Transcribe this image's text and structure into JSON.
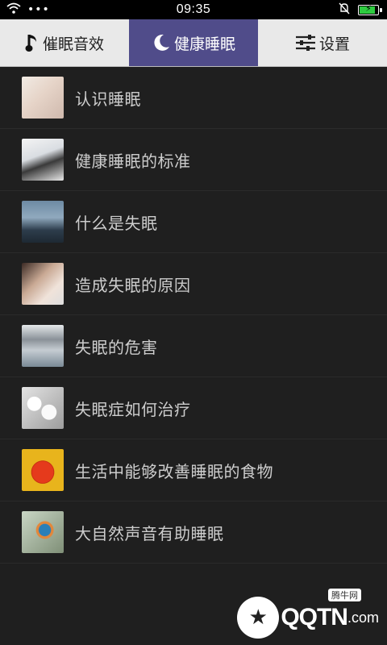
{
  "status_bar": {
    "time": "09:35",
    "battery_level": 0.9
  },
  "tabs": [
    {
      "label": "催眠音效",
      "icon": "music-note-icon",
      "active": false
    },
    {
      "label": "健康睡眠",
      "icon": "moon-icon",
      "active": true
    },
    {
      "label": "设置",
      "icon": "sliders-icon",
      "active": false
    }
  ],
  "items": [
    {
      "label": "认识睡眠",
      "thumb": "sleeping-baby-image"
    },
    {
      "label": "健康睡眠的标准",
      "thumb": "woman-resting-image"
    },
    {
      "label": "什么是失眠",
      "thumb": "person-at-window-image"
    },
    {
      "label": "造成失眠的原因",
      "thumb": "woman-headache-image"
    },
    {
      "label": "失眠的危害",
      "thumb": "eye-mask-image"
    },
    {
      "label": "失眠症如何治疗",
      "thumb": "pills-image"
    },
    {
      "label": "生活中能够改善睡眠的食物",
      "thumb": "apple-image"
    },
    {
      "label": "大自然声音有助睡眠",
      "thumb": "kingfisher-image"
    }
  ],
  "watermark": {
    "brand": "QQTN",
    "suffix": ".com",
    "tag": "腾牛网"
  },
  "colors": {
    "active_tab": "#504c8a",
    "background": "#1f1f1f"
  }
}
